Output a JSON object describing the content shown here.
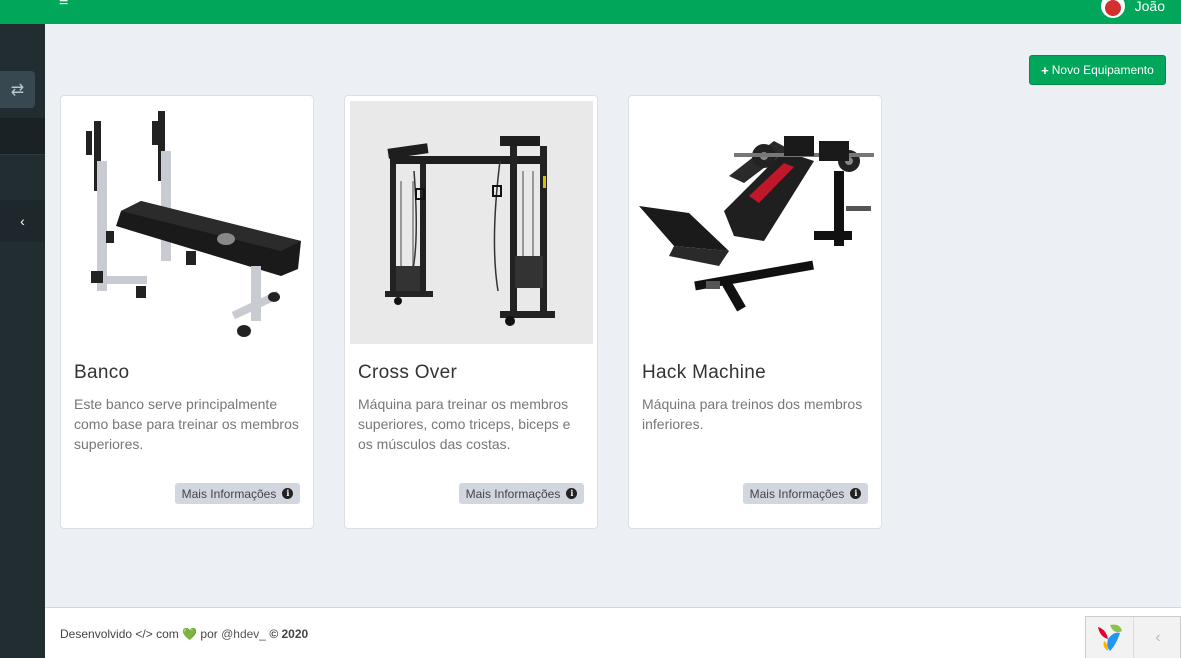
{
  "header": {
    "menu_icon": "hamburger-icon",
    "user_name": "João"
  },
  "sidebar": {
    "switch_icon": "exchange-icon",
    "toggle_icon": "chevron-left-icon"
  },
  "actions": {
    "new_equipment": "Novo Equipamento"
  },
  "equipment": [
    {
      "name": "Banco",
      "description": "Este banco serve principalmente como base para treinar os membros superiores.",
      "more": "Mais Informações"
    },
    {
      "name": "Cross Over",
      "description": "Máquina para treinar os membros superiores, como triceps, biceps e os músculos das costas.",
      "more": "Mais Informações"
    },
    {
      "name": "Hack Machine",
      "description": "Máquina para treinos dos membros inferiores.",
      "more": "Mais Informações"
    }
  ],
  "footer": {
    "developed": "Desenvolvido",
    "code_symbol": "</>",
    "with": "com",
    "heart": "💚",
    "by": "por",
    "handle": "@hdev_",
    "copyright": "© 2020"
  },
  "colors": {
    "brand": "#00a65a",
    "sidebar": "#222d32",
    "background": "#ecf0f5"
  }
}
